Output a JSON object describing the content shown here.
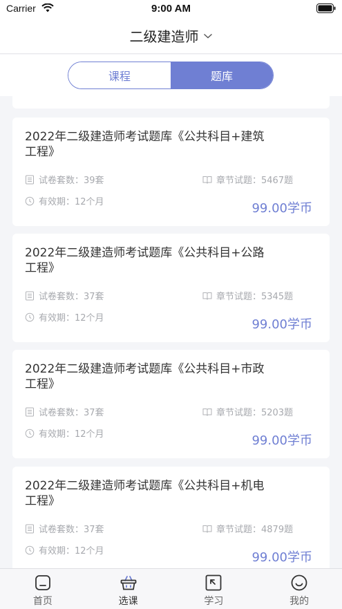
{
  "status_bar": {
    "carrier": "Carrier",
    "time": "9:00 AM"
  },
  "header": {
    "title": "二级建造师"
  },
  "segment_tabs": [
    {
      "label": "课程",
      "active": false
    },
    {
      "label": "题库",
      "active": true
    }
  ],
  "cards": [
    {
      "title_line1": "2022年二级建造师考试题库《公共科目+建筑",
      "title_line2": "工程》",
      "sets": "试卷套数：39套",
      "chapters": "章节试题：5467题",
      "validity": "有效期：12个月",
      "price": "99.00学币"
    },
    {
      "title_line1": "2022年二级建造师考试题库《公共科目+公路",
      "title_line2": "工程》",
      "sets": "试卷套数：37套",
      "chapters": "章节试题：5345题",
      "validity": "有效期：12个月",
      "price": "99.00学币"
    },
    {
      "title_line1": "2022年二级建造师考试题库《公共科目+市政",
      "title_line2": "工程》",
      "sets": "试卷套数：37套",
      "chapters": "章节试题：5203题",
      "validity": "有效期：12个月",
      "price": "99.00学币"
    },
    {
      "title_line1": "2022年二级建造师考试题库《公共科目+机电",
      "title_line2": "工程》",
      "sets": "试卷套数：37套",
      "chapters": "章节试题：4879题",
      "validity": "有效期：12个月",
      "price": "99.00学币"
    }
  ],
  "tab_bar": [
    {
      "label": "首页",
      "icon": "home-icon"
    },
    {
      "label": "选课",
      "icon": "basket-icon",
      "active": true
    },
    {
      "label": "学习",
      "icon": "study-icon"
    },
    {
      "label": "我的",
      "icon": "smiley-icon"
    }
  ],
  "colors": {
    "accent": "#6f7fd3",
    "price": "#6f7fd3",
    "meta_text": "#a7a9ae"
  }
}
